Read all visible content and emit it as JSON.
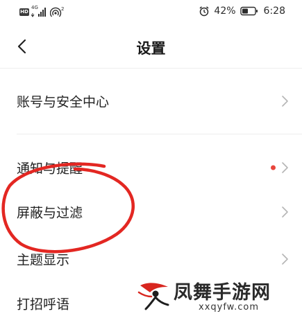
{
  "status_bar": {
    "hd_label": "HD",
    "network_label": "4G",
    "hotspot_count": "2",
    "battery_percent": "42%",
    "time": "6:28"
  },
  "header": {
    "back_icon": "chevron-left-icon",
    "title": "设置"
  },
  "settings": {
    "items": [
      {
        "label": "账号与安全中心",
        "icon": "chevron-right-icon",
        "has_dot": false
      },
      {
        "label": "通知与提醒",
        "icon": "chevron-right-icon",
        "has_dot": true
      },
      {
        "label": "屏蔽与过滤",
        "icon": "chevron-right-icon",
        "has_dot": false
      },
      {
        "label": "主题显示",
        "icon": "chevron-right-icon",
        "has_dot": false
      },
      {
        "label": "打招呼语",
        "icon": "chevron-right-icon",
        "has_dot": false
      }
    ]
  },
  "annotation": {
    "color": "#e32722",
    "target": "屏蔽与过滤"
  },
  "watermark": {
    "title": "凤舞手游网",
    "site": "xxqyfw.com",
    "accent_color": "#d8261f"
  },
  "colors": {
    "dot_red": "#e8453c",
    "divider": "#eeeeee",
    "text": "#222222"
  }
}
